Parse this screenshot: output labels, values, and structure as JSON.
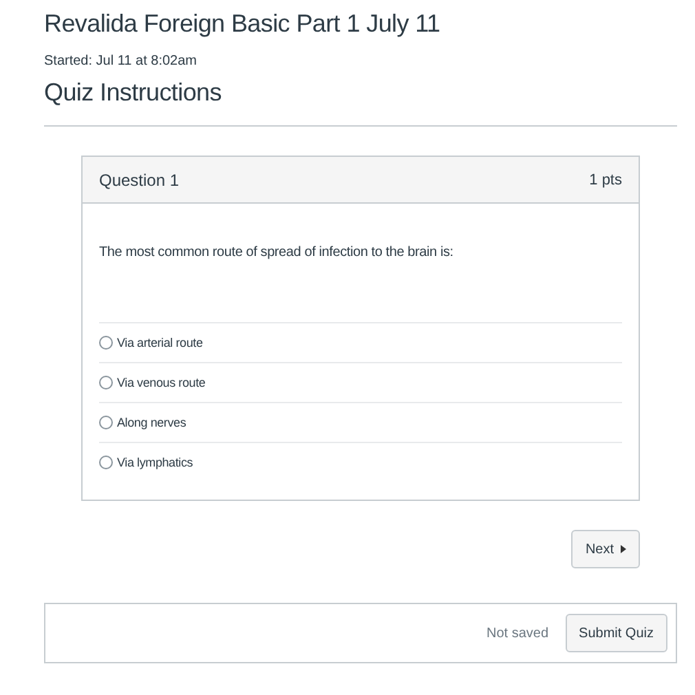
{
  "title": "Revalida Foreign Basic Part 1 July 11",
  "started": "Started: Jul 11 at 8:02am",
  "section_heading": "Quiz Instructions",
  "question": {
    "title": "Question 1",
    "points": "1 pts",
    "text": "The most common route of spread of infection to the brain is:",
    "answers": [
      {
        "label": "Via arterial route",
        "selected": false
      },
      {
        "label": "Via venous route",
        "selected": false
      },
      {
        "label": "Along nerves",
        "selected": false
      },
      {
        "label": "Via lymphatics",
        "selected": false
      }
    ]
  },
  "next_button": "Next",
  "footer": {
    "save_status": "Not saved",
    "submit_button": "Submit Quiz"
  }
}
